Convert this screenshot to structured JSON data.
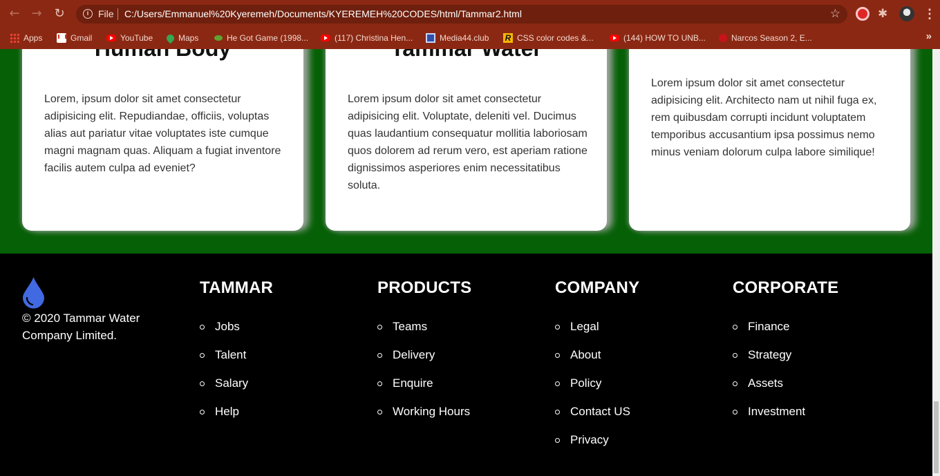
{
  "browser": {
    "file_label": "File",
    "url": "C:/Users/Emmanuel%20Kyeremeh/Documents/KYEREMEH%20CODES/html/Tammar2.html",
    "bookmarks": [
      {
        "label": "Apps",
        "icon": "apps-grid-icon"
      },
      {
        "label": "Gmail",
        "icon": "gmail-icon"
      },
      {
        "label": "YouTube",
        "icon": "youtube-icon"
      },
      {
        "label": "Maps",
        "icon": "maps-pin-icon"
      },
      {
        "label": "He Got Game (1998...",
        "icon": "game-icon"
      },
      {
        "label": "(117) Christina Hen...",
        "icon": "youtube-icon"
      },
      {
        "label": "Media44.club",
        "icon": "media-icon"
      },
      {
        "label": "CSS color codes &...",
        "icon": "r-logo-icon"
      },
      {
        "label": "(144) HOW TO UNB...",
        "icon": "youtube-icon"
      },
      {
        "label": "Narcos Season 2, E...",
        "icon": "narcos-icon"
      }
    ],
    "more_label": "»"
  },
  "cards": [
    {
      "title": "Human Body",
      "text": "Lorem, ipsum dolor sit amet consectetur adipisicing elit. Repudiandae, officiis, voluptas alias aut pariatur vitae voluptates iste cumque magni magnam quas. Aliquam a fugiat inventore facilis autem culpa ad eveniet?"
    },
    {
      "title": "Tammar Water",
      "text": "Lorem ipsum dolor sit amet consectetur adipisicing elit. Voluptate, deleniti vel. Ducimus quas laudantium consequatur mollitia laboriosam quos dolorem ad rerum vero, est aperiam ratione dignissimos asperiores enim necessitatibus soluta."
    },
    {
      "title": "",
      "text": "Lorem ipsum dolor sit amet consectetur adipisicing elit. Architecto nam ut nihil fuga ex, rem quibusdam corrupti incidunt voluptatem temporibus accusantium ipsa possimus nemo minus veniam dolorum culpa labore similique!"
    }
  ],
  "footer": {
    "copyright": "© 2020 Tammar Water Company Limited.",
    "columns": [
      {
        "title": "TAMMAR",
        "items": [
          "Jobs",
          "Talent",
          "Salary",
          "Help"
        ]
      },
      {
        "title": "PRODUCTS",
        "items": [
          "Teams",
          "Delivery",
          "Enquire",
          "Working Hours"
        ]
      },
      {
        "title": "COMPANY",
        "items": [
          "Legal",
          "About",
          "Policy",
          "Contact US",
          "Privacy"
        ]
      },
      {
        "title": "CORPORATE",
        "items": [
          "Finance",
          "Strategy",
          "Assets",
          "Investment"
        ]
      }
    ]
  },
  "colors": {
    "chrome": "#8b2813",
    "green_section": "#066006",
    "footer": "#000000",
    "drop": "#4169e1"
  }
}
